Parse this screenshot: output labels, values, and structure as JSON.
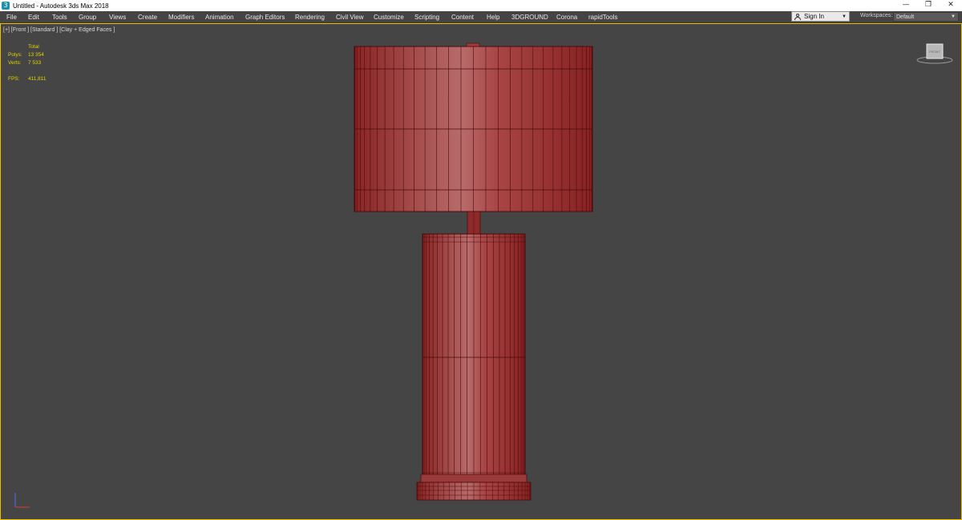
{
  "window": {
    "title": "Untitled - Autodesk 3ds Max 2018",
    "app_icon": "3",
    "controls": [
      "—",
      "❐",
      "✕"
    ]
  },
  "menu": [
    "File",
    "Edit",
    "Tools",
    "Group",
    "Views",
    "Create",
    "Modifiers",
    "Animation",
    "Graph Editors",
    "Rendering",
    "Civil View",
    "Customize",
    "Scripting",
    "Content",
    "Help",
    "3DGROUND",
    "Corona",
    "rapidTools"
  ],
  "account": {
    "signin_label": "Sign In"
  },
  "workspaces": {
    "label": "Workspaces:",
    "value": "Default"
  },
  "viewport": {
    "label": "[+] [Front ] [Standard ] [Clay + Edged Faces ]",
    "stats": {
      "header": "Total",
      "polys_label": "Polys:",
      "polys_value": "13 354",
      "verts_label": "Verts:",
      "verts_value": "7 533",
      "fps_label": "FPS:",
      "fps_value": "411,811"
    },
    "viewcube_face": "FRONT"
  },
  "colors": {
    "viewport_bg": "#454545",
    "border_active": "#f0c000",
    "stats_text": "#e2d400",
    "lamp_fill": "#a33030",
    "lamp_edge": "#5a0c0c"
  }
}
